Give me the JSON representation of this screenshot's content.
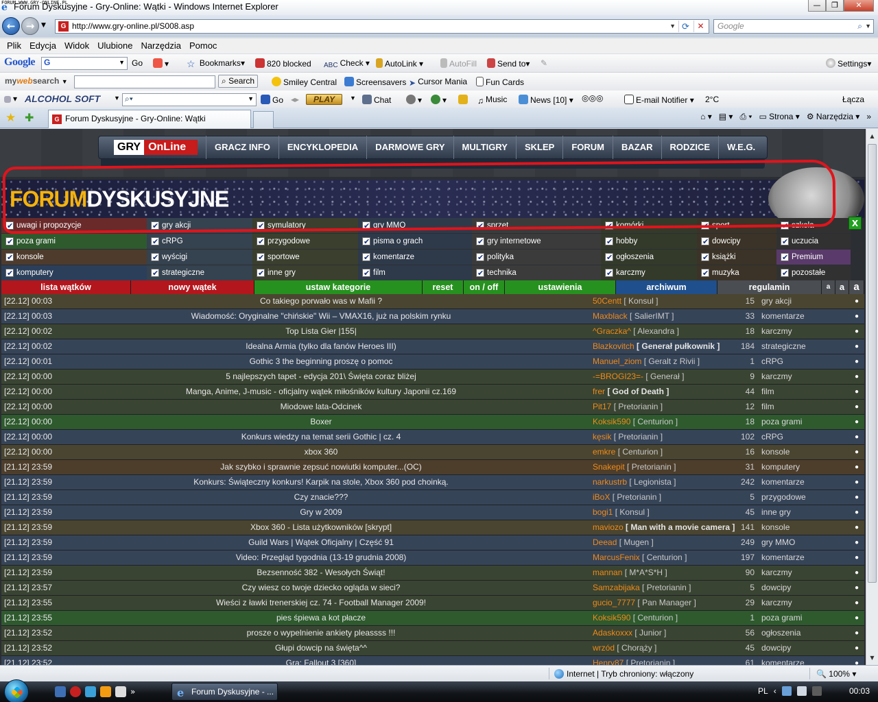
{
  "window": {
    "corner_text": "FORUM WWW.GRY-ONLINE.PL",
    "title": "Forum Dyskusyjne - Gry-Online: Wątki - Windows Internet Explorer"
  },
  "address": {
    "url": "http://www.gry-online.pl/S008.asp",
    "search_placeholder": "Google"
  },
  "menu": [
    "Plik",
    "Edycja",
    "Widok",
    "Ulubione",
    "Narzędzia",
    "Pomoc"
  ],
  "toolbar_google": {
    "logo": "Google",
    "go": "Go",
    "bookmarks": "Bookmarks",
    "blocked": "820 blocked",
    "check": "Check",
    "autolink": "AutoLink",
    "autofill": "AutoFill",
    "sendto": "Send to",
    "settings": "Settings"
  },
  "toolbar_mywebsearch": {
    "logo_a": "my",
    "logo_b": "web",
    "logo_c": "search",
    "search": "Search",
    "smiley": "Smiley Central",
    "screensavers": "Screensavers",
    "cursor": "Cursor Mania",
    "funcards": "Fun Cards"
  },
  "toolbar_alcohol": {
    "logo": "ALCOHOL SOFT",
    "go": "Go",
    "play": "PLAY",
    "chat": "Chat",
    "music": "Music",
    "news": "News",
    "news_count": "[10]",
    "email": "E-mail Notifier",
    "temp": "2°C",
    "links": "Łącza"
  },
  "tabs": {
    "active_title": "Forum Dyskusyjne - Gry-Online: Wątki",
    "strona": "Strona",
    "narzedzia": "Narzędzia"
  },
  "site": {
    "logo_a": "GRY",
    "logo_b": "OnLine",
    "nav": [
      "GRACZ INFO",
      "ENCYKLOPEDIA",
      "DARMOWE GRY",
      "MULTIGRY",
      "SKLEP",
      "FORUM",
      "BAZAR",
      "RODZICE",
      "W.E.G."
    ],
    "banner_a": "FORUM",
    "banner_b": "DYSKUSYJNE",
    "close_x": "X"
  },
  "categories": {
    "row0": [
      "uwagi i propozycje",
      "gry akcji",
      "symulatory",
      "gry MMO",
      "sprzęt",
      "komórki",
      "sport",
      "szkoła"
    ],
    "row1": [
      "poza grami",
      "cRPG",
      "przygodowe",
      "pisma o grach",
      "gry internetowe",
      "hobby",
      "dowcipy",
      "uczucia"
    ],
    "row2": [
      "konsole",
      "wyścigi",
      "sportowe",
      "komentarze",
      "polityka",
      "ogłoszenia",
      "książki",
      "Premium"
    ],
    "row3": [
      "komputery",
      "strategiczne",
      "inne gry",
      "film",
      "technika",
      "karczmy",
      "muzyka",
      "pozostałe"
    ]
  },
  "actions": {
    "lista": "lista wątków",
    "nowy": "nowy wątek",
    "ustaw": "ustaw kategorie",
    "reset": "reset",
    "onoff": "on / off",
    "ustawienia": "ustawienia",
    "archiwum": "archiwum",
    "regulamin": "regulamin",
    "fs1": "a",
    "fs2": "a",
    "fs3": "a"
  },
  "threads": [
    {
      "date": "[22.12] 00:03",
      "title": "Co takiego porwało was w Mafii ?",
      "nick": "50Centt",
      "rank": "[ Konsul ]",
      "bold": false,
      "count": "15",
      "cat": "gry akcji",
      "color": "#4a4530"
    },
    {
      "date": "[22.12] 00:03",
      "title": "Wiadomość: Oryginalne \"chińskie\" Wii – VMAX16, już na polskim rynku",
      "nick": "Maxblack",
      "rank": "[ SalierIMT ]",
      "bold": false,
      "count": "33",
      "cat": "komentarze",
      "color": "#364458"
    },
    {
      "date": "[22.12] 00:02",
      "title": "Top Lista Gier |155|",
      "nick": "^Graczka^",
      "rank": "[ Alexandra ]",
      "bold": false,
      "count": "18",
      "cat": "karczmy",
      "color": "#3a4432"
    },
    {
      "date": "[22.12] 00:02",
      "title": "Idealna Armia (tylko dla fanów Heroes III)",
      "nick": "Blazkovitch",
      "rank": "[ Generał pułkownik ]",
      "bold": true,
      "count": "184",
      "cat": "strategiczne",
      "color": "#364458"
    },
    {
      "date": "[22.12] 00:01",
      "title": "Gothic 3 the beginning proszę o pomoc",
      "nick": "Manuel_ziom",
      "rank": "[ Geralt z Rivii ]",
      "bold": false,
      "count": "1",
      "cat": "cRPG",
      "color": "#364458"
    },
    {
      "date": "[22.12] 00:00",
      "title": "5 najlepszych tapet - edycja 201\\ Święta coraz bliżej",
      "nick": "-=BROGI23=-",
      "rank": "[ Generał ]",
      "bold": false,
      "count": "9",
      "cat": "karczmy",
      "color": "#3a4432"
    },
    {
      "date": "[22.12] 00:00",
      "title": "Manga, Anime, J-music - oficjalny wątek miłośników kultury Japonii cz.169",
      "nick": "frer",
      "rank": "[ God of Death ]",
      "bold": true,
      "count": "44",
      "cat": "film",
      "color": "#3a4432"
    },
    {
      "date": "[22.12] 00:00",
      "title": "Miodowe lata-Odcinek",
      "nick": "Pit17",
      "rank": "[ Pretorianin ]",
      "bold": false,
      "count": "12",
      "cat": "film",
      "color": "#3a4432"
    },
    {
      "date": "[22.12] 00:00",
      "title": "Boxer",
      "nick": "Koksik590",
      "rank": "[ Centurion ]",
      "bold": false,
      "count": "18",
      "cat": "poza grami",
      "color": "#2e5a2e"
    },
    {
      "date": "[22.12] 00:00",
      "title": "Konkurs wiedzy na temat serii Gothic | cz. 4",
      "nick": "kęsik",
      "rank": "[ Pretorianin ]",
      "bold": false,
      "count": "102",
      "cat": "cRPG",
      "color": "#364458"
    },
    {
      "date": "[22.12] 00:00",
      "title": "xbox 360",
      "nick": "emkre",
      "rank": "[ Centurion ]",
      "bold": false,
      "count": "16",
      "cat": "konsole",
      "color": "#4a4530"
    },
    {
      "date": "[21.12] 23:59",
      "title": "Jak szybko i sprawnie zepsuć nowiutki komputer...(OC)",
      "nick": "Snakepit",
      "rank": "[ Pretorianin ]",
      "bold": false,
      "count": "31",
      "cat": "komputery",
      "color": "#4d3e2c"
    },
    {
      "date": "[21.12] 23:59",
      "title": "Konkurs: Świąteczny konkurs! Karpik na stole, Xbox 360 pod choinką.",
      "nick": "narkustrb",
      "rank": "[ Legionista ]",
      "bold": false,
      "count": "242",
      "cat": "komentarze",
      "color": "#364458"
    },
    {
      "date": "[21.12] 23:59",
      "title": "Czy znacie???",
      "nick": "iBoX",
      "rank": "[ Pretorianin ]",
      "bold": false,
      "count": "5",
      "cat": "przygodowe",
      "color": "#364458"
    },
    {
      "date": "[21.12] 23:59",
      "title": "Gry w 2009",
      "nick": "bogi1",
      "rank": "[ Konsul ]",
      "bold": false,
      "count": "45",
      "cat": "inne gry",
      "color": "#364458"
    },
    {
      "date": "[21.12] 23:59",
      "title": "Xbox 360 - Lista użytkowników [skrypt]",
      "nick": "maviozo",
      "rank": "[ Man with a movie camera ]",
      "bold": true,
      "count": "141",
      "cat": "konsole",
      "color": "#4a4530"
    },
    {
      "date": "[21.12] 23:59",
      "title": "Guild Wars | Wątek Oficjalny | Część 91",
      "nick": "Deead",
      "rank": "[ Mugen ]",
      "bold": false,
      "count": "249",
      "cat": "gry MMO",
      "color": "#364458"
    },
    {
      "date": "[21.12] 23:59",
      "title": "Video: Przegląd tygodnia (13-19 grudnia 2008)",
      "nick": "MarcusFenix",
      "rank": "[ Centurion ]",
      "bold": false,
      "count": "197",
      "cat": "komentarze",
      "color": "#364458"
    },
    {
      "date": "[21.12] 23:59",
      "title": "Bezsenność 382 - Wesołych Świąt!",
      "nick": "mannan",
      "rank": "[ M*A*S*H ]",
      "bold": false,
      "count": "90",
      "cat": "karczmy",
      "color": "#3a4432"
    },
    {
      "date": "[21.12] 23:57",
      "title": "Czy wiesz co twoje dziecko ogląda w sieci?",
      "nick": "Samzabijaka",
      "rank": "[ Pretorianin ]",
      "bold": false,
      "count": "5",
      "cat": "dowcipy",
      "color": "#3a4432"
    },
    {
      "date": "[21.12] 23:55",
      "title": "Wieści z ławki trenerskiej cz. 74 - Football Manager 2009!",
      "nick": "gucio_7777",
      "rank": "[ Pan Manager ]",
      "bold": false,
      "count": "29",
      "cat": "karczmy",
      "color": "#3a4432"
    },
    {
      "date": "[21.12] 23:55",
      "title": "pies śpiewa a kot płacze",
      "nick": "Koksik590",
      "rank": "[ Centurion ]",
      "bold": false,
      "count": "1",
      "cat": "poza grami",
      "color": "#2e5a2e"
    },
    {
      "date": "[21.12] 23:52",
      "title": "prosze o wypelnienie ankiety pleassss !!!",
      "nick": "Adaskoxxx",
      "rank": "[ Junior ]",
      "bold": false,
      "count": "56",
      "cat": "ogłoszenia",
      "color": "#3a4432"
    },
    {
      "date": "[21.12] 23:52",
      "title": "Głupi dowcip na święta^^",
      "nick": "wrzód",
      "rank": "[ Chorąży ]",
      "bold": false,
      "count": "45",
      "cat": "dowcipy",
      "color": "#3a4432"
    },
    {
      "date": "[21.12] 23:52",
      "title": "Gra: Fallout 3 [360]",
      "nick": "Henry87",
      "rank": "[ Pretorianin ]",
      "bold": false,
      "count": "61",
      "cat": "komentarze",
      "color": "#364458"
    }
  ],
  "status": {
    "zone": "Internet | Tryb chroniony: włączony",
    "zoom": "100%"
  },
  "taskbar": {
    "task": "Forum Dyskusyjne - ...",
    "lang": "PL",
    "clock": "00:03"
  }
}
